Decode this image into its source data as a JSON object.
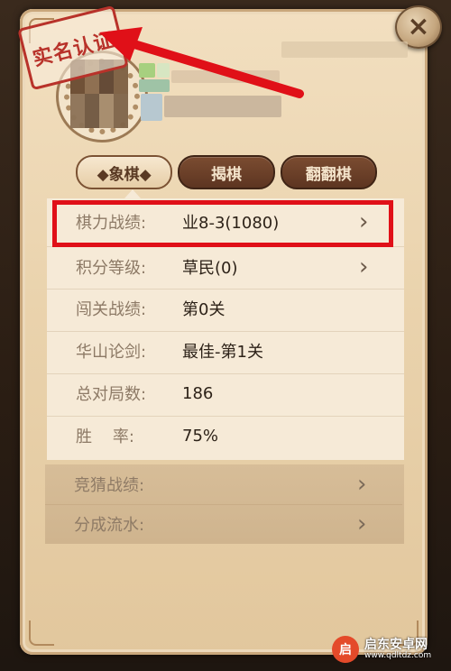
{
  "close": {
    "label": "×"
  },
  "stamp": {
    "text": "实名认证"
  },
  "tabs": [
    {
      "label": "◆象棋◆",
      "active": true
    },
    {
      "label": "揭棋",
      "active": false
    },
    {
      "label": "翻翻棋",
      "active": false
    }
  ],
  "stats": [
    {
      "label": "棋力战绩:",
      "value": "业8-3(1080)",
      "chevron": "›"
    },
    {
      "label": "积分等级:",
      "value": "草民(0)",
      "chevron": "›"
    },
    {
      "label": "闯关战绩:",
      "value": "第0关"
    },
    {
      "label": "华山论剑:",
      "value": "最佳-第1关"
    },
    {
      "label": "总对局数:",
      "value": "186"
    },
    {
      "label": "胜    率:",
      "value": "75%"
    }
  ],
  "lower": [
    {
      "label": "竞猜战绩:",
      "chevron": "›"
    },
    {
      "label": "分成流水:",
      "chevron": "›"
    }
  ],
  "watermark": {
    "logo": "启",
    "line1": "启东安卓网",
    "line2": "www.qdltdz.com"
  },
  "colors": {
    "highlight": "#e01018",
    "arrow": "#e01018",
    "stamp": "#b8322a"
  }
}
